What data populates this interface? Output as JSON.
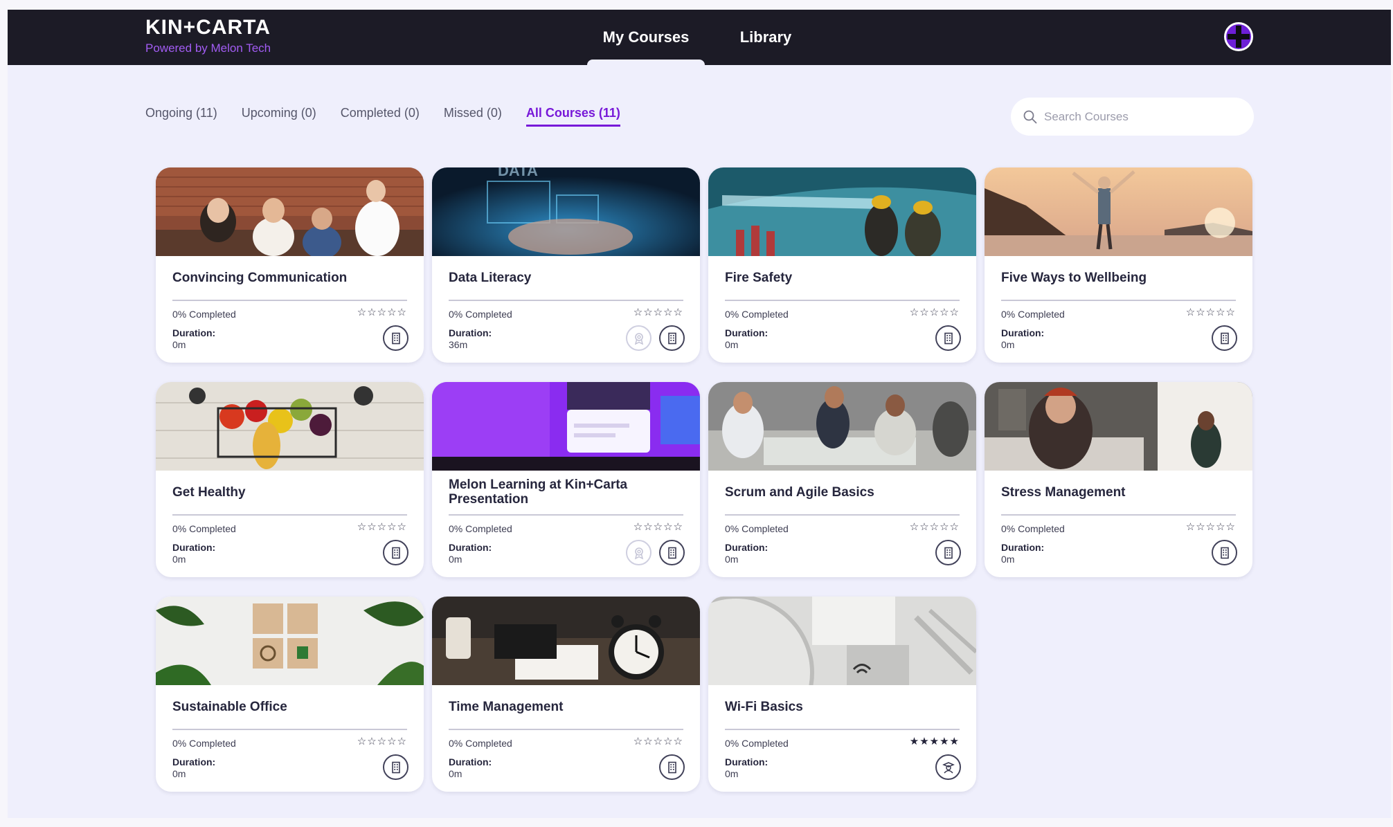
{
  "header": {
    "brand": "KIN+CARTA",
    "tagline": "Powered by Melon Tech",
    "nav": {
      "my_courses": "My Courses",
      "library": "Library"
    }
  },
  "filters": {
    "tabs": [
      "Ongoing (11)",
      "Upcoming (0)",
      "Completed (0)",
      "Missed (0)",
      "All Courses (11)"
    ],
    "active": "All Courses (11)"
  },
  "search": {
    "placeholder": "Search Courses"
  },
  "labels": {
    "duration": "Duration:"
  },
  "colors": {
    "topbar": "#1c1b26",
    "accent": "#7718d8",
    "brand_sub": "#a25cf3",
    "background": "#efeffc"
  },
  "courses": [
    {
      "title": "Convincing Communication",
      "progress": "0% Completed",
      "rating": 0,
      "duration": "0m",
      "icons": [
        "building-icon"
      ]
    },
    {
      "title": "Data Literacy",
      "progress": "0% Completed",
      "rating": 0,
      "duration": "36m",
      "icons": [
        "certificate-icon",
        "building-icon"
      ]
    },
    {
      "title": "Fire Safety",
      "progress": "0% Completed",
      "rating": 0,
      "duration": "0m",
      "icons": [
        "building-icon"
      ]
    },
    {
      "title": "Five Ways to Wellbeing",
      "progress": "0% Completed",
      "rating": 0,
      "duration": "0m",
      "icons": [
        "building-icon"
      ]
    },
    {
      "title": "Get Healthy",
      "progress": "0% Completed",
      "rating": 0,
      "duration": "0m",
      "icons": [
        "building-icon"
      ]
    },
    {
      "title": "Melon Learning at Kin+Carta Presentation",
      "progress": "0% Completed",
      "rating": 0,
      "duration": "0m",
      "icons": [
        "certificate-icon",
        "building-icon"
      ]
    },
    {
      "title": "Scrum and Agile Basics",
      "progress": "0% Completed",
      "rating": 0,
      "duration": "0m",
      "icons": [
        "building-icon"
      ]
    },
    {
      "title": "Stress Management",
      "progress": "0% Completed",
      "rating": 0,
      "duration": "0m",
      "icons": [
        "building-icon"
      ]
    },
    {
      "title": "Sustainable Office",
      "progress": "0% Completed",
      "rating": 0,
      "duration": "0m",
      "icons": [
        "building-icon"
      ]
    },
    {
      "title": "Time Management",
      "progress": "0% Completed",
      "rating": 0,
      "duration": "0m",
      "icons": [
        "building-icon"
      ]
    },
    {
      "title": "Wi-Fi Basics",
      "progress": "0% Completed",
      "rating": 5,
      "duration": "0m",
      "icons": [
        "graduate-icon"
      ]
    }
  ]
}
